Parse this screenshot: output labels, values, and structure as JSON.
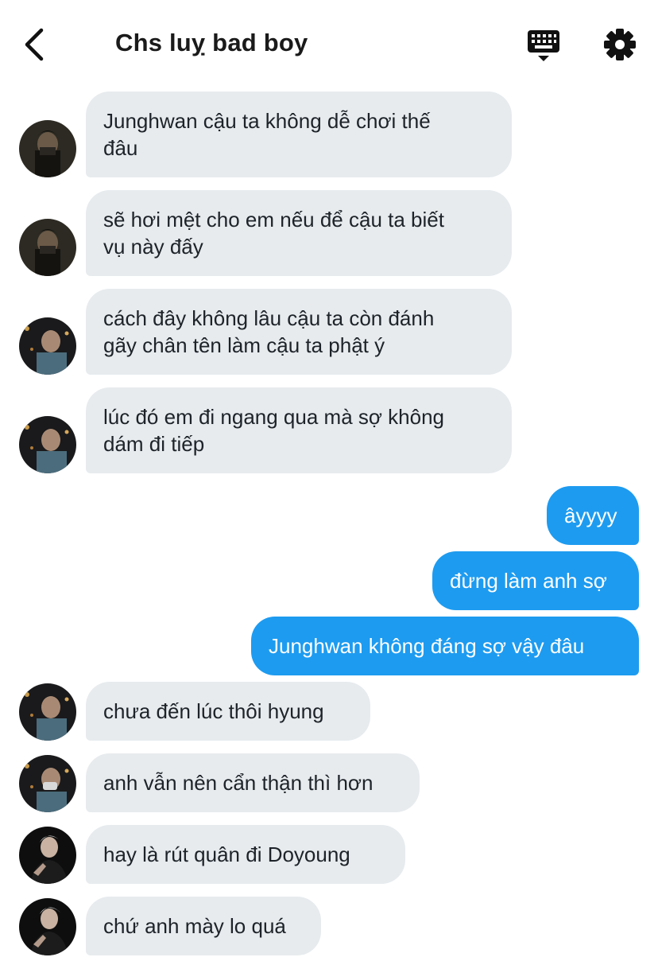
{
  "header": {
    "title": "Chs luỵ bad boy",
    "back_icon": "chevron-left-icon",
    "keyboard_icon": "keyboard-icon",
    "settings_icon": "gear-icon"
  },
  "colors": {
    "incoming_bubble": "#e7ebee",
    "outgoing_bubble": "#1d9bf0",
    "outgoing_text": "#ffffff"
  },
  "messages": [
    {
      "direction": "incoming",
      "text": "Junghwan cậu ta không dễ chơi thế\nđâu"
    },
    {
      "direction": "incoming",
      "text": "sẽ hơi mệt cho em nếu để cậu ta biết\nvụ này đấy"
    },
    {
      "direction": "incoming",
      "text": "cách đây không lâu cậu ta còn đánh\ngãy chân tên làm cậu ta phật ý"
    },
    {
      "direction": "incoming",
      "text": "lúc đó em đi ngang qua mà sợ không\ndám đi tiếp"
    },
    {
      "direction": "outgoing",
      "text": "âyyyy"
    },
    {
      "direction": "outgoing",
      "text": "đừng làm anh sợ"
    },
    {
      "direction": "outgoing",
      "text": "Junghwan không đáng sợ vậy đâu"
    },
    {
      "direction": "incoming",
      "text": "chưa đến lúc thôi hyung"
    },
    {
      "direction": "incoming",
      "text": "anh vẫn nên cẩn thận thì hơn"
    },
    {
      "direction": "incoming",
      "text": "hay là rút quân đi Doyoung"
    },
    {
      "direction": "incoming",
      "text": "chứ anh mày lo quá"
    }
  ]
}
